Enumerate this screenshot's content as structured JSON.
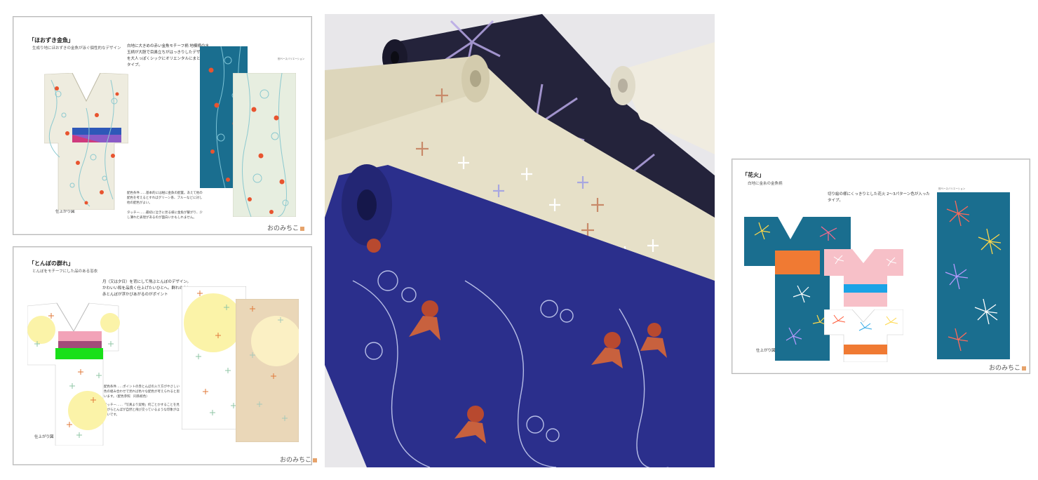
{
  "panel_goldfish": {
    "title": "「ほおずき金魚」",
    "subtitle": "生成り地にほおずきの金魚が泳ぐ個性的なデザイン",
    "body": "白地に大きめの赤い金魚モチーフ柄 地模様の水玉柄が大胆で目鼻立ちがはっきりしたデザインを大人っぽくシックにオリエンタルにまとめたタイプ。",
    "note_1": "配色条件……基本的には紺に金魚の配置。あえて他の配色を考えるとすればグリーン系、ブルーなどに対し他の配色がよい。",
    "note_2": "タッチー……最初に泣きに見る様に金魚が繋がり、少し薄れた表現があるのが面白いかもしれません。",
    "caption": "仕上がり図",
    "swatch_label": "別ベースバリエーション",
    "signature": "おのみちこ"
  },
  "panel_dragonfly": {
    "title": "「とんぼの群れ」",
    "subtitle": "とんぼをモチーフにした品のある浴衣",
    "body": "月（又は夕日）を背にして飛ぶとんぼのデザイン。かわいい和を品良く仕上げたいひとへ。群れの中に赤とんぼが浮かびあがるのがポイント",
    "note_1": "配色条件……ポイントの赤とんぼの入り方がやさしい色の組み合わせで見れば色々な配色が考えられると思います。（配色参照　同系統色）",
    "note_2": "タッチー……「写真より実物」何ごとかすることを見ながらとんぼが自然と飛び交っているような印象がほしいです。",
    "caption": "仕上がり図",
    "signature": "おのみちこ"
  },
  "panel_fireworks": {
    "title": "「花火」",
    "subtitle": "白地に金糸の金魚柄",
    "body": "切り絵の様にくっきりとした花火 2〜3パターン色が入ったタイプ。",
    "caption": "仕上がり図",
    "swatch_label": "別ベースバリエーション",
    "signature": "おのみちこ"
  },
  "photo": {
    "subject": "rolled yukata fabrics: navy goldfish, cream dragonfly, dark purple fireworks"
  },
  "colors": {
    "teal": "#1a6e8f",
    "navy": "#2a2f8e",
    "cream": "#e9e3cf",
    "goldfish_red": "#e0482f",
    "obi_orange": "#f07a33",
    "obi_pink": "#f2a3b8",
    "obi_green": "#19e019",
    "moon": "#fbf3a8",
    "dark_plum": "#22213a"
  }
}
